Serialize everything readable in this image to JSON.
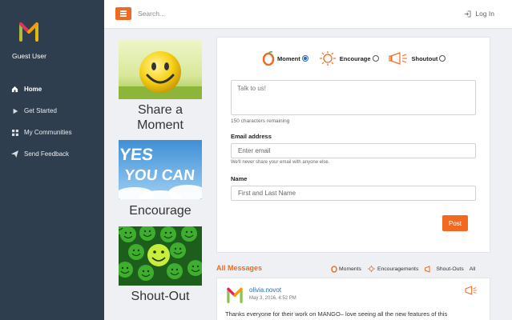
{
  "sidebar": {
    "user": "Guest User",
    "items": [
      {
        "label": "Home",
        "icon": "home-icon",
        "active": true
      },
      {
        "label": "Get Started",
        "icon": "play-icon"
      },
      {
        "label": "My Communities",
        "icon": "grid-icon"
      },
      {
        "label": "Send Feedback",
        "icon": "send-icon"
      }
    ]
  },
  "topbar": {
    "search_placeholder": "Search...",
    "login": "Log In"
  },
  "cards": [
    {
      "label_line1": "Share a",
      "label_line2": "Moment",
      "image": "smiley-ball-image"
    },
    {
      "label": "Encourage",
      "image_text_line1": "YES",
      "image_text_line2": "YOU CAN"
    },
    {
      "label": "Shout-Out",
      "image": "green-smileys-image"
    }
  ],
  "form": {
    "types": [
      {
        "label": "Moment",
        "icon": "moment-icon",
        "checked": true
      },
      {
        "label": "Encourage",
        "icon": "sun-icon",
        "checked": false
      },
      {
        "label": "Shoutout",
        "icon": "megaphone-icon",
        "checked": false
      }
    ],
    "message_placeholder": "Talk to us!",
    "chars_remaining": "150 characters remaining",
    "email_label": "Email address",
    "email_placeholder": "Enter email",
    "email_help": "We'll never share your email with anyone else.",
    "name_label": "Name",
    "name_placeholder": "First and Last Name",
    "post_label": "Post"
  },
  "messages": {
    "title": "All Messages",
    "filters": [
      {
        "label": "Moments",
        "icon": "moment-icon"
      },
      {
        "label": "Encouragements",
        "icon": "sun-icon"
      },
      {
        "label": "Shout-Outs",
        "icon": "megaphone-icon"
      },
      {
        "label": "All"
      }
    ],
    "items": [
      {
        "author": "olivia.novot",
        "date": "May 3, 2016, 4:52 PM",
        "text": "Thanks everyone for their work on MANGO– love seeing all the new features of this"
      }
    ]
  },
  "colors": {
    "accent": "#f26a21",
    "sidebar": "#2f3e4e",
    "link": "#2a6db5"
  }
}
